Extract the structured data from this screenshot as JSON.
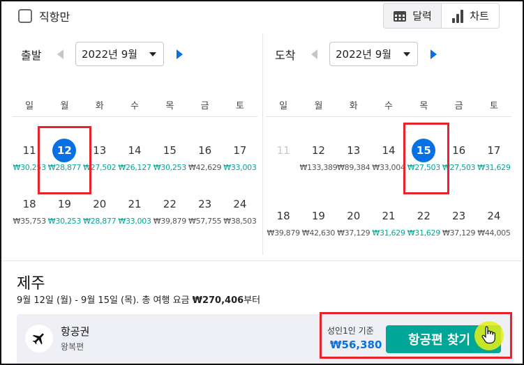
{
  "toolbar": {
    "direct_only_label": "직항만",
    "view_calendar_label": "달력",
    "view_chart_label": "차트"
  },
  "departure": {
    "label": "출발",
    "month": "2022년 9월",
    "weekdays": [
      "일",
      "월",
      "화",
      "수",
      "목",
      "금",
      "토"
    ],
    "weeks": [
      [
        {
          "day": "11",
          "price": "₩30,253",
          "low": true
        },
        {
          "day": "12",
          "price": "₩28,877",
          "low": true,
          "selected": true
        },
        {
          "day": "13",
          "price": "₩27,502",
          "low": true
        },
        {
          "day": "14",
          "price": "₩26,127",
          "low": true
        },
        {
          "day": "15",
          "price": "₩30,253",
          "low": true
        },
        {
          "day": "16",
          "price": "₩42,629",
          "low": false
        },
        {
          "day": "17",
          "price": "₩33,003",
          "low": true
        }
      ],
      [
        {
          "day": "18",
          "price": "₩35,753",
          "low": false
        },
        {
          "day": "19",
          "price": "₩30,253",
          "low": true
        },
        {
          "day": "20",
          "price": "₩28,877",
          "low": true
        },
        {
          "day": "21",
          "price": "₩33,003",
          "low": true
        },
        {
          "day": "22",
          "price": "₩39,879",
          "low": false
        },
        {
          "day": "23",
          "price": "₩57,755",
          "low": false
        },
        {
          "day": "24",
          "price": "₩38,503",
          "low": false
        }
      ]
    ]
  },
  "arrival": {
    "label": "도착",
    "month": "2022년 9월",
    "weekdays": [
      "일",
      "월",
      "화",
      "수",
      "목",
      "금",
      "토"
    ],
    "weeks": [
      [
        {
          "day": "11",
          "price": "",
          "muted": true
        },
        {
          "day": "12",
          "price": "₩133,389",
          "low": false
        },
        {
          "day": "13",
          "price": "₩89,384",
          "low": false
        },
        {
          "day": "14",
          "price": "₩33,004",
          "low": false
        },
        {
          "day": "15",
          "price": "₩27,503",
          "low": true,
          "selected": true
        },
        {
          "day": "16",
          "price": "₩27,503",
          "low": true
        },
        {
          "day": "17",
          "price": "₩31,629",
          "low": true
        }
      ],
      [
        {
          "day": "18",
          "price": "₩39,879",
          "low": false
        },
        {
          "day": "19",
          "price": "₩42,630",
          "low": false
        },
        {
          "day": "20",
          "price": "₩37,129",
          "low": false
        },
        {
          "day": "21",
          "price": "₩31,629",
          "low": true
        },
        {
          "day": "22",
          "price": "₩31,629",
          "low": true
        },
        {
          "day": "23",
          "price": "₩37,129",
          "low": false
        },
        {
          "day": "24",
          "price": "₩44,005",
          "low": false
        }
      ]
    ]
  },
  "result": {
    "destination": "제주",
    "summary_prefix": "9월 12일 (월) - 9월 15일 (목). 총 여행 요금 ",
    "summary_total": "₩270,406",
    "summary_suffix": "부터",
    "card_title": "항공권",
    "card_sub": "왕복편",
    "per_person_label": "성인1인 기준",
    "per_person_price": "₩56,380",
    "cta_label": "항공편 찾기"
  },
  "colors": {
    "accent": "#0770e3",
    "low_price": "#00a698",
    "highlight_box": "#e8232b"
  }
}
